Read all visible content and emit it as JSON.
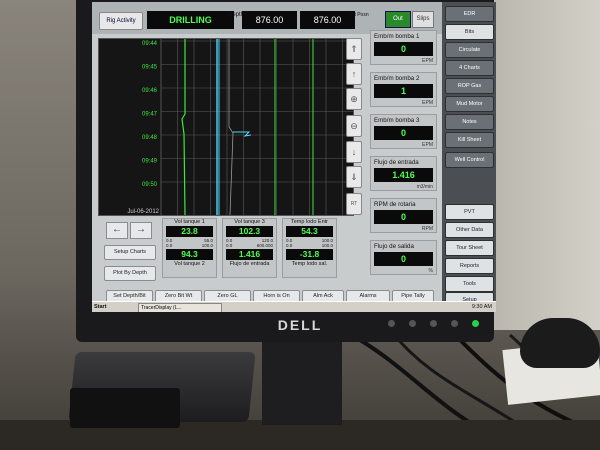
{
  "topbar": {
    "rig_activity": "Rig Activity",
    "status": "DRILLING",
    "depth_label": "Depth",
    "depth_value": "876.00",
    "bit_pos_label": "Bit Posn",
    "bit_pos_value": "876.00",
    "out_label": "Out",
    "slips_label": "Slips"
  },
  "chart": {
    "times": [
      "09:44",
      "09:45",
      "09:46",
      "09:47",
      "09:48",
      "09:49",
      "09:50"
    ],
    "date": "Jul-06-2012"
  },
  "panels": [
    {
      "label": "Emb/m bomba 1",
      "value": "0",
      "unit": "EPM"
    },
    {
      "label": "Emb/m bomba 2",
      "value": "1",
      "unit": "EPM"
    },
    {
      "label": "Emb/m bomba 3",
      "value": "0",
      "unit": "EPM"
    },
    {
      "label": "Flujo de entrada",
      "value": "1.416",
      "unit": "m3/min"
    },
    {
      "label": "RPM de rotaria",
      "value": "0",
      "unit": "RPM"
    },
    {
      "label": "Flujo de salida",
      "value": "0",
      "unit": "%"
    }
  ],
  "gauges": [
    {
      "top_label": "Vol tanque 1",
      "top_value": "23.8",
      "range1": [
        "0.0",
        "55.0"
      ],
      "range2": [
        "0.0",
        "100.0"
      ],
      "bottom_value": "94.3",
      "bottom_label": "Vol tanque 2"
    },
    {
      "top_label": "Vol tanque 3",
      "top_value": "102.3",
      "range1": [
        "0.0",
        "120.0"
      ],
      "range2": [
        "0.0",
        "600.000"
      ],
      "bottom_value": "1.416",
      "bottom_label": "Flujo de entrada"
    },
    {
      "top_label": "Temp lodo Entr",
      "top_value": "54.3",
      "range1": [
        "0.0",
        "100.0"
      ],
      "range2": [
        "0.0",
        "100.0"
      ],
      "bottom_value": "-31.8",
      "bottom_label": "Temp lodo sal."
    }
  ],
  "left_buttons": {
    "setup_charts": "Setup Charts",
    "plot_by_depth": "Plot By Depth"
  },
  "sidebar": [
    {
      "label": "EDR",
      "style": "normal"
    },
    {
      "label": "Bits",
      "style": "light"
    },
    {
      "label": "Circulate",
      "style": "normal"
    },
    {
      "label": "4 Charts",
      "style": "normal"
    },
    {
      "label": "ROP Gas",
      "style": "normal"
    },
    {
      "label": "Mud Motor",
      "style": "normal"
    },
    {
      "label": "Notes",
      "style": "normal"
    },
    {
      "label": "Kill Sheet",
      "style": "normal"
    },
    {
      "label": "Well Control",
      "style": "normal"
    },
    {
      "label": "PVT",
      "style": "light"
    },
    {
      "label": "Other Data",
      "style": "light"
    },
    {
      "label": "Tour Sheet",
      "style": "light"
    },
    {
      "label": "Reports",
      "style": "light"
    },
    {
      "label": "Tools",
      "style": "light"
    },
    {
      "label": "Setup",
      "style": "light"
    }
  ],
  "bottom_buttons": [
    "Set Depth/Bit",
    "Zero Bit Wt",
    "Zero GL",
    "Horn is On",
    "Alm Ack",
    "Alarms",
    "Pipe Tally"
  ],
  "taskbar": {
    "start": "Start",
    "task": "TracerDisplay (L...",
    "clock": "9:30 AM"
  },
  "monitor": {
    "brand": "DELL"
  },
  "colors": {
    "accent_green": "#4fff4f",
    "trace_cyan": "#4fd6ff",
    "trace_green": "#3ee83e"
  }
}
